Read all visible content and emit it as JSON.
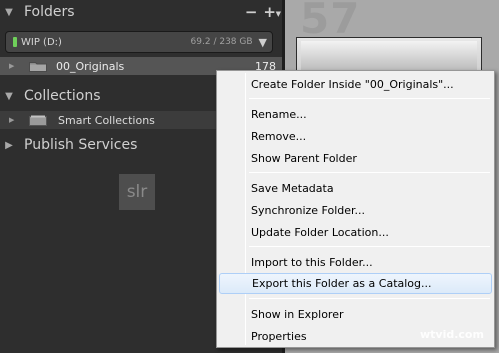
{
  "panels": {
    "folders": {
      "title": "Folders",
      "minus": "−",
      "plus": "+"
    },
    "collections": {
      "title": "Collections"
    },
    "publish": {
      "title": "Publish Services"
    }
  },
  "volume": {
    "name": "WIP (D:)",
    "size": "69.2 / 238 GB"
  },
  "folder": {
    "name": "00_Originals",
    "count": "178"
  },
  "collection": {
    "name": "Smart Collections"
  },
  "badge": "slr",
  "grid": {
    "cell_number": "57"
  },
  "context_menu": {
    "items": [
      "Create Folder Inside \"00_Originals\"...",
      "Rename...",
      "Remove...",
      "Show Parent Folder",
      "Save Metadata",
      "Synchronize Folder...",
      "Update Folder Location...",
      "Import to this Folder...",
      "Export this Folder as a Catalog...",
      "Show in Explorer",
      "Properties"
    ],
    "highlighted_index": 8
  },
  "watermark": "wtvid.com",
  "colors": {
    "panel_bg": "#2e2e2e",
    "selected_row": "#555555",
    "menu_bg": "#f0f0f0",
    "menu_highlight": "#dceaf9",
    "volume_led": "#6fd05a"
  },
  "icons": {
    "collapse": "triangle-down-icon",
    "expand": "triangle-right-icon",
    "folder": "folder-icon",
    "smart_collection": "smart-collection-icon",
    "dropdown": "caret-down-icon"
  }
}
